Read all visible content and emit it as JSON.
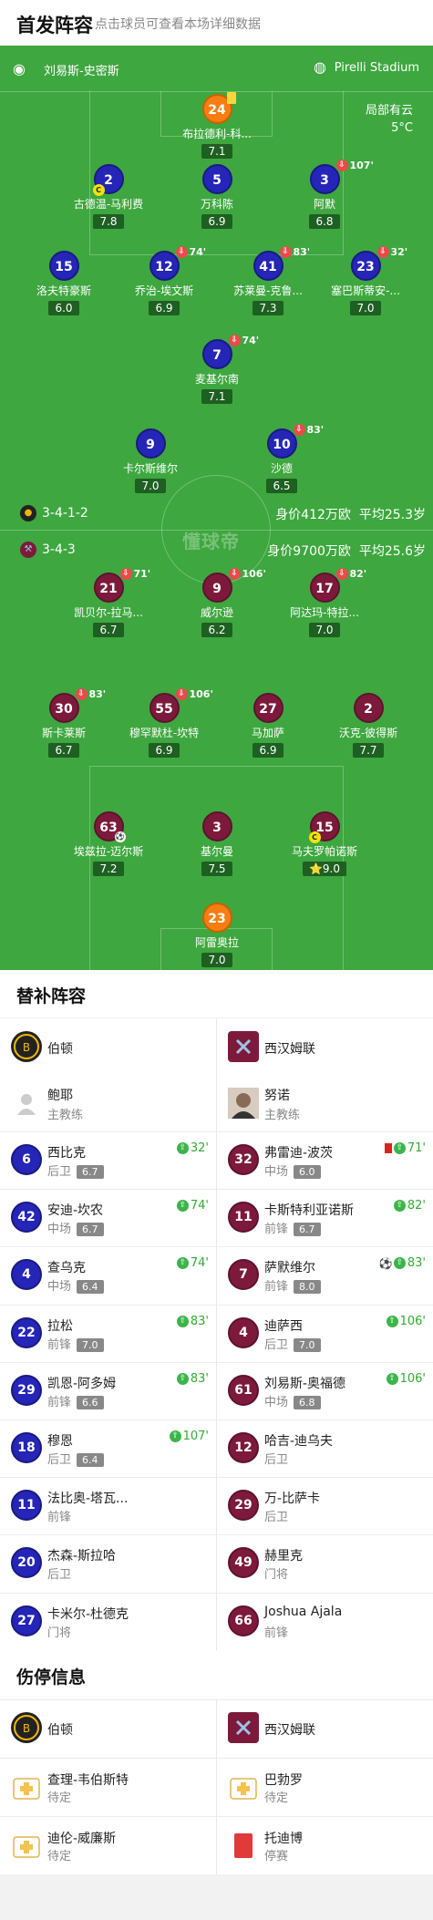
{
  "header": {
    "title": "首发阵容",
    "subtitle": "点击球员可查看本场详细数据"
  },
  "pitch": {
    "referee": "刘易斯-史密斯",
    "stadium": "Pirelli Stadium",
    "weather": "局部有云",
    "temperature": "5°C",
    "watermark": "懂球帝",
    "home_formation": "3-4-1-2",
    "home_value": "身价412万欧",
    "home_age": "平均25.3岁",
    "away_formation": "3-4-3",
    "away_value": "身价9700万欧",
    "away_age": "平均25.6岁"
  },
  "home_players": [
    {
      "num": "24",
      "name": "布拉德利-科...",
      "rating": "7.1"
    },
    {
      "num": "2",
      "name": "古德温-马利费",
      "rating": "7.8"
    },
    {
      "num": "5",
      "name": "万科陈",
      "rating": "6.9"
    },
    {
      "num": "3",
      "name": "阿默",
      "rating": "6.8",
      "sub": "107'"
    },
    {
      "num": "15",
      "name": "洛夫特豪斯",
      "rating": "6.0"
    },
    {
      "num": "12",
      "name": "乔治-埃文斯",
      "rating": "6.9",
      "sub": "74'"
    },
    {
      "num": "41",
      "name": "苏莱曼-克鲁...",
      "rating": "7.3",
      "sub": "83'"
    },
    {
      "num": "23",
      "name": "塞巴斯蒂安-...",
      "rating": "7.0",
      "sub": "32'"
    },
    {
      "num": "7",
      "name": "麦基尔南",
      "rating": "7.1",
      "sub": "74'"
    },
    {
      "num": "9",
      "name": "卡尔斯维尔",
      "rating": "7.0"
    },
    {
      "num": "10",
      "name": "沙德",
      "rating": "6.5",
      "sub": "83'"
    }
  ],
  "away_players": [
    {
      "num": "21",
      "name": "凯贝尔-拉马...",
      "rating": "6.7",
      "sub": "71'"
    },
    {
      "num": "9",
      "name": "威尔逊",
      "rating": "6.2",
      "sub": "106'"
    },
    {
      "num": "17",
      "name": "阿达玛-特拉...",
      "rating": "7.0",
      "sub": "82'"
    },
    {
      "num": "30",
      "name": "斯卡莱斯",
      "rating": "6.7",
      "sub": "83'"
    },
    {
      "num": "55",
      "name": "穆罕默杜-坎特",
      "rating": "6.9",
      "sub": "106'"
    },
    {
      "num": "27",
      "name": "马加萨",
      "rating": "6.9"
    },
    {
      "num": "2",
      "name": "沃克-彼得斯",
      "rating": "7.7"
    },
    {
      "num": "63",
      "name": "埃兹拉-迈尔斯",
      "rating": "7.2"
    },
    {
      "num": "3",
      "name": "基尔曼",
      "rating": "7.5"
    },
    {
      "num": "15",
      "name": "马夫罗帕诺斯",
      "rating": "9.0",
      "star": "⭐"
    },
    {
      "num": "23",
      "name": "阿雷奥拉",
      "rating": "7.0"
    }
  ],
  "subs": {
    "title": "替补阵容",
    "home_team": "伯顿",
    "away_team": "西汉姆联",
    "home_coach": "鲍耶",
    "away_coach": "努诺",
    "coach_label": "主教练",
    "home": [
      {
        "num": "6",
        "name": "西比克",
        "pos": "后卫",
        "rating": "6.7",
        "min": "32'"
      },
      {
        "num": "42",
        "name": "安迪-坎农",
        "pos": "中场",
        "rating": "6.7",
        "min": "74'"
      },
      {
        "num": "4",
        "name": "查乌克",
        "pos": "中场",
        "rating": "6.4",
        "min": "74'"
      },
      {
        "num": "22",
        "name": "拉松",
        "pos": "前锋",
        "rating": "7.0",
        "min": "83'"
      },
      {
        "num": "29",
        "name": "凯恩-阿多姆",
        "pos": "前锋",
        "rating": "6.6",
        "min": "83'"
      },
      {
        "num": "18",
        "name": "穆恩",
        "pos": "后卫",
        "rating": "6.4",
        "min": "107'"
      },
      {
        "num": "11",
        "name": "法比奥-塔瓦...",
        "pos": "前锋",
        "rating": "",
        "min": ""
      },
      {
        "num": "20",
        "name": "杰森-斯拉哈",
        "pos": "后卫",
        "rating": "",
        "min": ""
      },
      {
        "num": "27",
        "name": "卡米尔-杜德克",
        "pos": "门将",
        "rating": "",
        "min": ""
      }
    ],
    "away": [
      {
        "num": "32",
        "name": "弗雷迪-波茨",
        "pos": "中场",
        "rating": "6.0",
        "min": "71'",
        "red": true
      },
      {
        "num": "11",
        "name": "卡斯特利亚诺斯",
        "pos": "前锋",
        "rating": "6.7",
        "min": "82'"
      },
      {
        "num": "7",
        "name": "萨默维尔",
        "pos": "前锋",
        "rating": "8.0",
        "min": "83'",
        "goal": true
      },
      {
        "num": "4",
        "name": "迪萨西",
        "pos": "后卫",
        "rating": "7.0",
        "min": "106'"
      },
      {
        "num": "61",
        "name": "刘易斯-奥福德",
        "pos": "中场",
        "rating": "6.8",
        "min": "106'"
      },
      {
        "num": "12",
        "name": "哈吉-迪乌夫",
        "pos": "后卫",
        "rating": "",
        "min": ""
      },
      {
        "num": "29",
        "name": "万-比萨卡",
        "pos": "后卫",
        "rating": "",
        "min": ""
      },
      {
        "num": "49",
        "name": "赫里克",
        "pos": "门将",
        "rating": "",
        "min": ""
      },
      {
        "num": "66",
        "name": "Joshua Ajala",
        "pos": "前锋",
        "rating": "",
        "min": ""
      }
    ]
  },
  "injuries": {
    "title": "伤停信息",
    "home_team": "伯顿",
    "away_team": "西汉姆联",
    "home": [
      {
        "name": "查理-韦伯斯特",
        "status": "待定"
      },
      {
        "name": "迪伦-威廉斯",
        "status": "待定"
      }
    ],
    "away": [
      {
        "name": "巴勃罗",
        "status": "待定"
      },
      {
        "name": "托迪博",
        "status": "停赛"
      }
    ]
  },
  "colors": {
    "pitch": "#3ea73f",
    "home": "#2525b8",
    "away": "#7d1a3c",
    "gk": "#f57d12"
  }
}
